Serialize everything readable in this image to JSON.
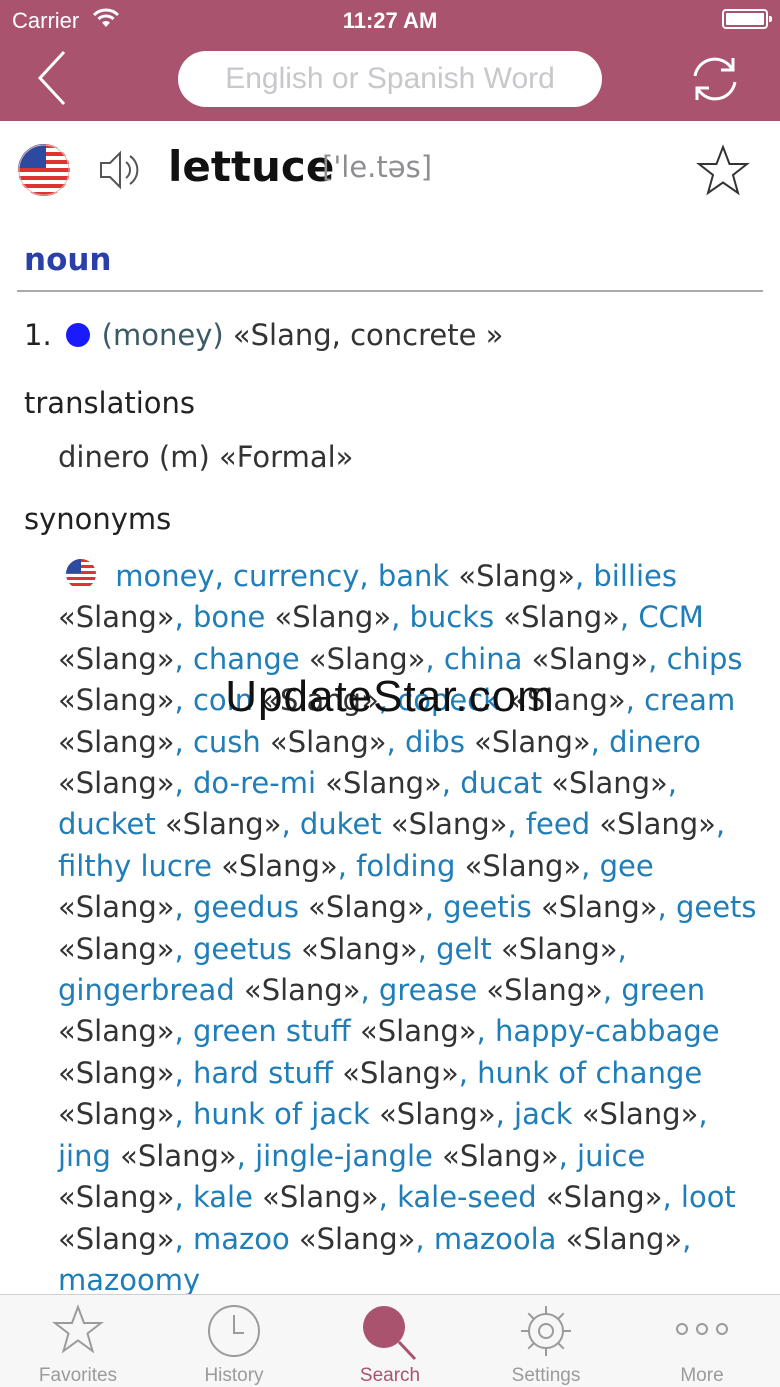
{
  "status_bar": {
    "carrier": "Carrier",
    "time": "11:27 AM"
  },
  "nav": {
    "search_placeholder": "English or Spanish Word"
  },
  "entry": {
    "word": "lettuce",
    "pronunciation": "['le.təs]",
    "part_of_speech": "noun",
    "sense_number": "1.",
    "sense_context": "(money)",
    "sense_note": "«Slang, concrete »",
    "translations_heading": "translations",
    "translation": "dinero (m) «Formal»",
    "synonyms_heading": "synonyms",
    "synonyms": [
      {
        "w": "money",
        "l": ""
      },
      {
        "w": "currency",
        "l": ""
      },
      {
        "w": "bank",
        "l": "«Slang»"
      },
      {
        "w": "billies",
        "l": "«Slang»"
      },
      {
        "w": "bone",
        "l": "«Slang»"
      },
      {
        "w": "bucks",
        "l": "«Slang»"
      },
      {
        "w": "CCM",
        "l": "«Slang»"
      },
      {
        "w": "change",
        "l": "«Slang»"
      },
      {
        "w": "china",
        "l": "«Slang»"
      },
      {
        "w": "chips",
        "l": "«Slang»"
      },
      {
        "w": "coin",
        "l": "«Slang»"
      },
      {
        "w": "copeck",
        "l": "«Slang»"
      },
      {
        "w": "cream",
        "l": "«Slang»"
      },
      {
        "w": "cush",
        "l": "«Slang»"
      },
      {
        "w": "dibs",
        "l": "«Slang»"
      },
      {
        "w": "dinero",
        "l": "«Slang»"
      },
      {
        "w": "do-re-mi",
        "l": "«Slang»"
      },
      {
        "w": "ducat",
        "l": "«Slang»"
      },
      {
        "w": "ducket",
        "l": "«Slang»"
      },
      {
        "w": "duket",
        "l": "«Slang»"
      },
      {
        "w": "feed",
        "l": "«Slang»"
      },
      {
        "w": "filthy lucre",
        "l": "«Slang»"
      },
      {
        "w": "folding",
        "l": "«Slang»"
      },
      {
        "w": "gee",
        "l": "«Slang»"
      },
      {
        "w": "geedus",
        "l": "«Slang»"
      },
      {
        "w": "geetis",
        "l": "«Slang»"
      },
      {
        "w": "geets",
        "l": "«Slang»"
      },
      {
        "w": "geetus",
        "l": "«Slang»"
      },
      {
        "w": "gelt",
        "l": "«Slang»"
      },
      {
        "w": "gingerbread",
        "l": "«Slang»"
      },
      {
        "w": "grease",
        "l": "«Slang»"
      },
      {
        "w": "green",
        "l": "«Slang»"
      },
      {
        "w": "green stuff",
        "l": "«Slang»"
      },
      {
        "w": "happy-cabbage",
        "l": "«Slang»"
      },
      {
        "w": "hard stuff",
        "l": "«Slang»"
      },
      {
        "w": "hunk of change",
        "l": "«Slang»"
      },
      {
        "w": "hunk of jack",
        "l": "«Slang»"
      },
      {
        "w": "jack",
        "l": "«Slang»"
      },
      {
        "w": "jing",
        "l": "«Slang»"
      },
      {
        "w": "jingle-jangle",
        "l": "«Slang»"
      },
      {
        "w": "juice",
        "l": "«Slang»"
      },
      {
        "w": "kale",
        "l": "«Slang»"
      },
      {
        "w": "kale-seed",
        "l": "«Slang»"
      },
      {
        "w": "loot",
        "l": "«Slang»"
      },
      {
        "w": "mazoo",
        "l": "«Slang»"
      },
      {
        "w": "mazoola",
        "l": "«Slang»"
      },
      {
        "w": "mazoomy",
        "l": ""
      }
    ]
  },
  "watermark": "UpdateStar.com",
  "tabs": [
    {
      "label": "Favorites",
      "icon": "star-icon"
    },
    {
      "label": "History",
      "icon": "clock-icon"
    },
    {
      "label": "Search",
      "icon": "magnifier-icon",
      "active": true
    },
    {
      "label": "Settings",
      "icon": "gear-icon"
    },
    {
      "label": "More",
      "icon": "more-dots-icon"
    }
  ],
  "colors": {
    "accent": "#a9536f",
    "link": "#1f7db8",
    "pos": "#2a40a8",
    "dot": "#1a1aff"
  }
}
